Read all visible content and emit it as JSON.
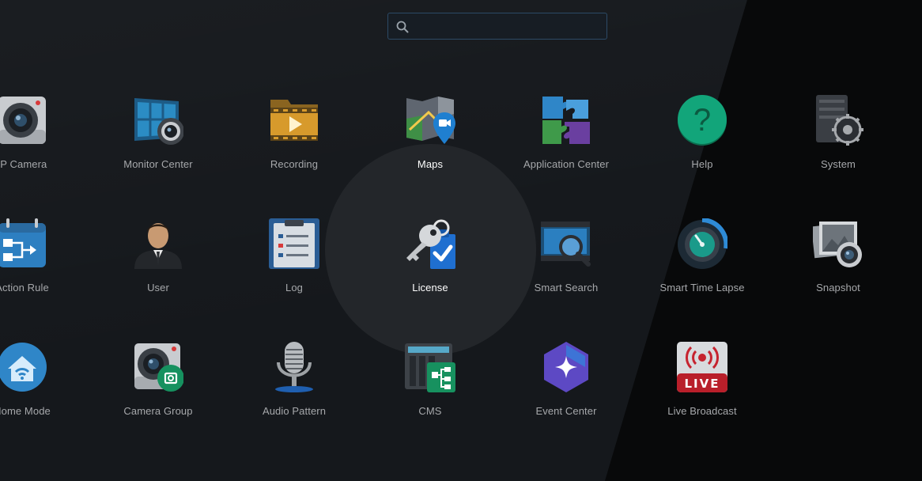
{
  "search": {
    "value": "",
    "placeholder": ""
  },
  "apps": {
    "ip_camera": "IP Camera",
    "monitor_center": "Monitor Center",
    "recording": "Recording",
    "maps": "Maps",
    "application_center": "Application Center",
    "help": "Help",
    "system": "System",
    "action_rule": "Action Rule",
    "user": "User",
    "log": "Log",
    "license": "License",
    "smart_search": "Smart Search",
    "smart_time_lapse": "Smart Time Lapse",
    "snapshot": "Snapshot",
    "home_mode": "Home Mode",
    "camera_group": "Camera Group",
    "audio_pattern": "Audio Pattern",
    "cms": "CMS",
    "event_center": "Event Center",
    "live_broadcast": "Live Broadcast"
  },
  "icon_text": {
    "help_glyph": "?",
    "live_badge": "LIVE"
  },
  "colors": {
    "background": "#15181c",
    "label": "#a6a8ab",
    "label_active": "#ffffff",
    "search_border": "#2c4a66",
    "highlight": "#23262a"
  }
}
